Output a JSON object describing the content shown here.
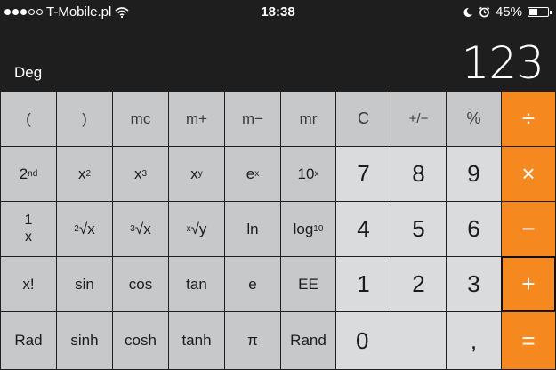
{
  "status_bar": {
    "signal_full": 3,
    "signal_empty": 2,
    "carrier": "T-Mobile.pl",
    "time": "18:38",
    "battery_pct": "45%",
    "battery_level": 0.45
  },
  "display": {
    "mode": "Deg",
    "value": "123"
  },
  "keys": {
    "open_paren": "(",
    "close_paren": ")",
    "mc": "mc",
    "m_plus": "m+",
    "m_minus": "m−",
    "mr": "mr",
    "clear": "C",
    "plus_minus": "+/−",
    "percent": "%",
    "divide": "÷",
    "second": "2",
    "second_sup": "nd",
    "x_base": "x",
    "sup_2": "2",
    "sup_3": "3",
    "sup_y": "y",
    "e_base": "e",
    "sup_x": "x",
    "ten_base": "10",
    "seven": "7",
    "eight": "8",
    "nine": "9",
    "multiply": "×",
    "recip_num": "1",
    "recip_den": "x",
    "sqrt2_index": "2",
    "sqrt3_index": "3",
    "sqrty_index": "x",
    "radical": "√",
    "sqrt_x": "x",
    "sqrt_y": "y",
    "ln": "ln",
    "log_base": "log",
    "log_sub": "10",
    "four": "4",
    "five": "5",
    "six": "6",
    "minus": "−",
    "factorial": "x!",
    "sin": "sin",
    "cos": "cos",
    "tan": "tan",
    "e": "e",
    "ee": "EE",
    "one": "1",
    "two": "2",
    "three": "3",
    "plus": "+",
    "rad": "Rad",
    "sinh": "sinh",
    "cosh": "cosh",
    "tanh": "tanh",
    "pi": "π",
    "rand": "Rand",
    "zero": "0",
    "decimal": ",",
    "equals": "="
  },
  "colors": {
    "operator": "#f5891f",
    "function_key": "#c6c8ca",
    "number_key": "#d9dbdd",
    "background": "#1e1e1e"
  },
  "icons": [
    "wifi-icon",
    "moon-icon",
    "alarm-icon",
    "battery-icon"
  ]
}
